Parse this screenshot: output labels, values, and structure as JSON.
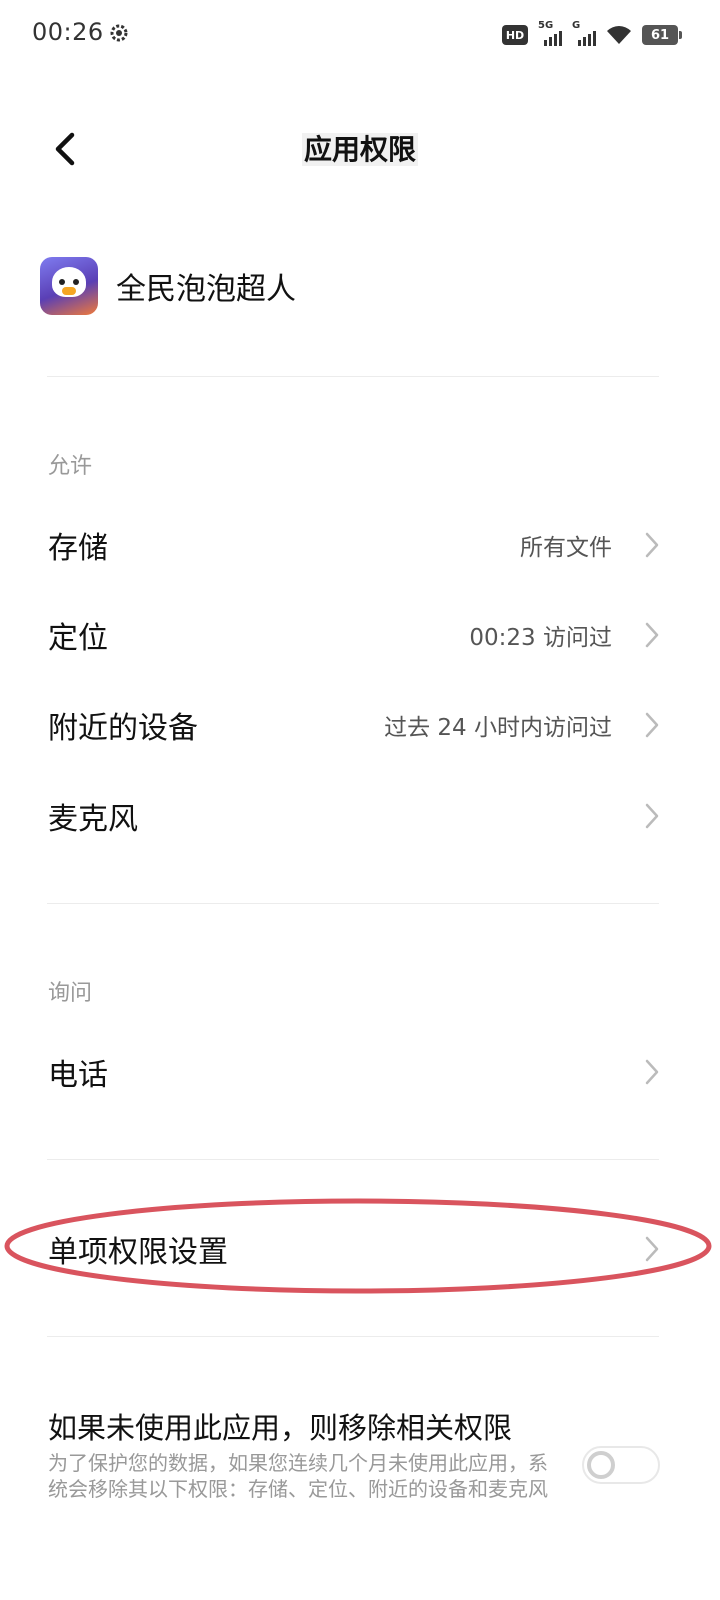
{
  "status_bar": {
    "time": "00:26",
    "hd": "HD",
    "signal1_label": "5G",
    "signal2_label": "G",
    "battery": "61"
  },
  "header": {
    "back_icon": "chevron-left-icon",
    "title": "应用权限"
  },
  "app": {
    "name": "全民泡泡超人"
  },
  "sections": {
    "allowed_label": "允许",
    "ask_label": "询问"
  },
  "allowed_permissions": [
    {
      "label": "存储",
      "value": "所有文件"
    },
    {
      "label": "定位",
      "value": "00:23 访问过"
    },
    {
      "label": "附近的设备",
      "value": "过去 24 小时内访问过"
    },
    {
      "label": "麦克风",
      "value": ""
    }
  ],
  "ask_permissions": [
    {
      "label": "电话",
      "value": ""
    }
  ],
  "individual_settings": {
    "label": "单项权限设置"
  },
  "auto_remove": {
    "title": "如果未使用此应用，则移除相关权限",
    "description": "为了保护您的数据，如果您连续几个月未使用此应用，系统会移除其以下权限：存储、定位、附近的设备和麦克风",
    "enabled": false
  },
  "colors": {
    "highlight": "#d9545e",
    "divider": "#ececec",
    "secondary_text": "#999999"
  }
}
